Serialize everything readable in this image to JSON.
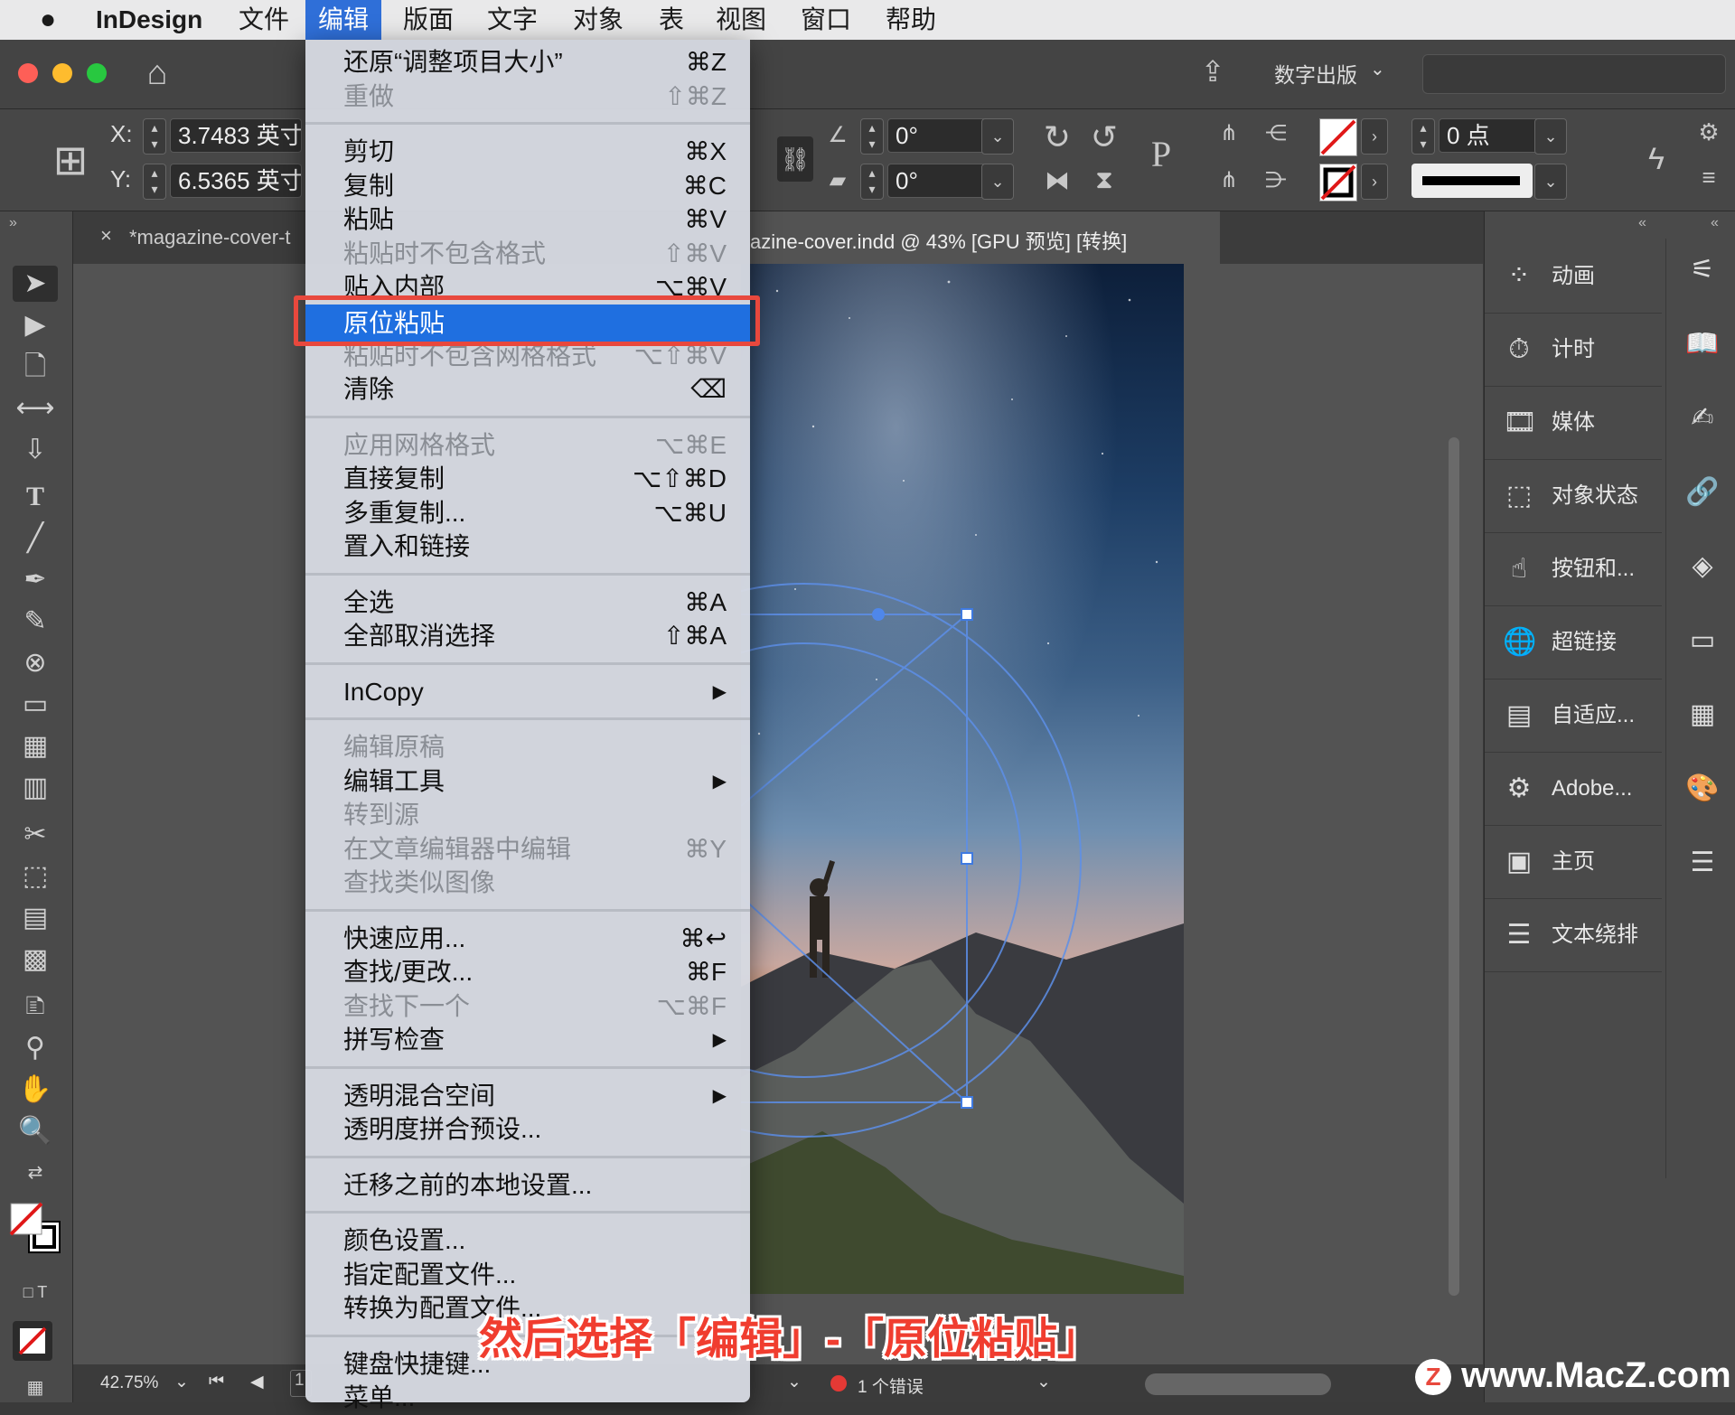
{
  "menubar": {
    "items": [
      "InDesign",
      "文件",
      "编辑",
      "版面",
      "文字",
      "对象",
      "表",
      "视图",
      "窗口",
      "帮助"
    ],
    "active": "编辑"
  },
  "titlebar": {
    "publish_label": "数字出版"
  },
  "control": {
    "x_label": "X:",
    "x_value": "3.7483 英寸",
    "y_label": "Y:",
    "y_value": "6.5365 英寸",
    "angle1": "0°",
    "angle2": "0°",
    "stroke_weight": "0 点",
    "p_glyph": "P"
  },
  "tabs": {
    "tab1": "*magazine-cover-t",
    "tab2": "azine-cover.indd @ 43% [GPU 预览] [转换]",
    "close": "×"
  },
  "menu": {
    "items": [
      {
        "label": "还原“调整项目大小”",
        "shortcut": "⌘Z",
        "disabled": false
      },
      {
        "label": "重做",
        "shortcut": "⇧⌘Z",
        "disabled": true
      },
      {
        "sep": true
      },
      {
        "label": "剪切",
        "shortcut": "⌘X",
        "disabled": false
      },
      {
        "label": "复制",
        "shortcut": "⌘C",
        "disabled": false
      },
      {
        "label": "粘贴",
        "shortcut": "⌘V",
        "disabled": false
      },
      {
        "label": "粘贴时不包含格式",
        "shortcut": "⇧⌘V",
        "disabled": true
      },
      {
        "label": "贴入内部",
        "shortcut": "⌥⌘V",
        "disabled": false
      },
      {
        "label": "原位粘贴",
        "shortcut": "",
        "disabled": false,
        "selected": true
      },
      {
        "label": "粘贴时不包含网格格式",
        "shortcut": "⌥⇧⌘V",
        "disabled": true
      },
      {
        "label": "清除",
        "shortcut": "⌫",
        "disabled": false
      },
      {
        "sep": true
      },
      {
        "label": "应用网格格式",
        "shortcut": "⌥⌘E",
        "disabled": true
      },
      {
        "label": "直接复制",
        "shortcut": "⌥⇧⌘D",
        "disabled": false
      },
      {
        "label": "多重复制...",
        "shortcut": "⌥⌘U",
        "disabled": false
      },
      {
        "label": "置入和链接",
        "shortcut": "",
        "disabled": false
      },
      {
        "sep": true
      },
      {
        "label": "全选",
        "shortcut": "⌘A",
        "disabled": false
      },
      {
        "label": "全部取消选择",
        "shortcut": "⇧⌘A",
        "disabled": false
      },
      {
        "sep": true
      },
      {
        "label": "InCopy",
        "shortcut": "▶",
        "disabled": false
      },
      {
        "sep": true
      },
      {
        "label": "编辑原稿",
        "shortcut": "",
        "disabled": true
      },
      {
        "label": "编辑工具",
        "shortcut": "▶",
        "disabled": false
      },
      {
        "label": "转到源",
        "shortcut": "",
        "disabled": true
      },
      {
        "label": "在文章编辑器中编辑",
        "shortcut": "⌘Y",
        "disabled": true
      },
      {
        "label": "查找类似图像",
        "shortcut": "",
        "disabled": true
      },
      {
        "sep": true
      },
      {
        "label": "快速应用...",
        "shortcut": "⌘↩",
        "disabled": false
      },
      {
        "label": "查找/更改...",
        "shortcut": "⌘F",
        "disabled": false
      },
      {
        "label": "查找下一个",
        "shortcut": "⌥⌘F",
        "disabled": true
      },
      {
        "label": "拼写检查",
        "shortcut": "▶",
        "disabled": false
      },
      {
        "sep": true
      },
      {
        "label": "透明混合空间",
        "shortcut": "▶",
        "disabled": false
      },
      {
        "label": "透明度拼合预设...",
        "shortcut": "",
        "disabled": false
      },
      {
        "sep": true
      },
      {
        "label": "迁移之前的本地设置...",
        "shortcut": "",
        "disabled": false
      },
      {
        "sep": true
      },
      {
        "label": "颜色设置...",
        "shortcut": "",
        "disabled": false
      },
      {
        "label": "指定配置文件...",
        "shortcut": "",
        "disabled": false
      },
      {
        "label": "转换为配置文件...",
        "shortcut": "",
        "disabled": false
      },
      {
        "sep": true
      },
      {
        "label": "键盘快捷键...",
        "shortcut": "",
        "disabled": false
      },
      {
        "label": "菜单...",
        "shortcut": "",
        "disabled": false
      }
    ]
  },
  "panels": {
    "items": [
      {
        "label": "动画",
        "icon": "animation-icon"
      },
      {
        "label": "计时",
        "icon": "timer-icon"
      },
      {
        "label": "媒体",
        "icon": "media-icon"
      },
      {
        "label": "对象状态",
        "icon": "object-states-icon"
      },
      {
        "label": "按钮和...",
        "icon": "buttons-icon"
      },
      {
        "label": "超链接",
        "icon": "hyperlinks-icon"
      },
      {
        "label": "自适应...",
        "icon": "liquid-layout-icon"
      },
      {
        "label": "Adobe...",
        "icon": "adobe-icon"
      },
      {
        "label": "主页",
        "icon": "pages-icon"
      },
      {
        "label": "文本绕排",
        "icon": "text-wrap-icon"
      }
    ]
  },
  "status": {
    "zoom": "42.75%",
    "errors": "1 个错误",
    "page": "1"
  },
  "caption": "然后选择「编辑」-「原位粘贴」",
  "watermark": "www.MacZ.com",
  "watermark_badge": "Z",
  "colors": {
    "menu_highlight": "#1f6fe0",
    "annotation_red": "#e8483d",
    "error_dot": "#e53935"
  }
}
